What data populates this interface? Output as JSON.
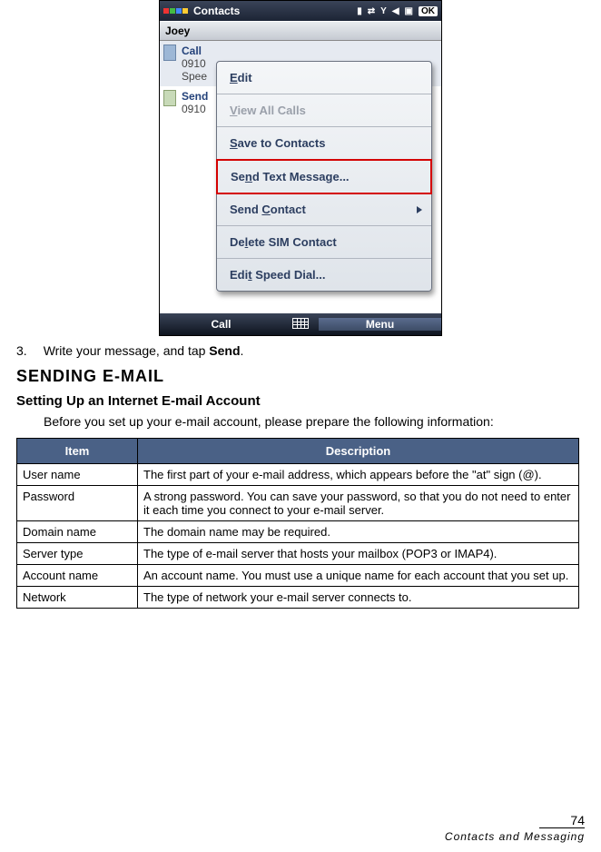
{
  "screenshot": {
    "statusbar": {
      "title": "Contacts",
      "ok": "OK"
    },
    "subheader": "Joey",
    "entries": [
      {
        "line1": "Call",
        "line2a": "0910",
        "line2b": "Spee"
      },
      {
        "line1": "Send",
        "line2a": "0910"
      }
    ],
    "menu": {
      "edit": "Edit",
      "viewall": "View All Calls",
      "savecontacts": "Save to Contacts",
      "sendtext": "Send Text Message...",
      "sendcontact": "Send Contact",
      "deletesim": "Delete SIM Contact",
      "editspeed": "Edit Speed Dial..."
    },
    "softkeys": {
      "left": "Call",
      "right": "Menu"
    }
  },
  "step3": {
    "pre": "Write your message, and tap ",
    "bold": "Send",
    "post": "."
  },
  "heading": "Sending e-mail",
  "subheading": "Setting Up an Internet E-mail Account",
  "intro": "Before you set up your e-mail account, please prepare the following information:",
  "table": {
    "head": {
      "item": "Item",
      "desc": "Description"
    },
    "rows": [
      {
        "item": "User name",
        "desc": "The first part of your e-mail address, which appears before the \"at\" sign (@)."
      },
      {
        "item": "Password",
        "desc": "A strong password. You can save your password, so that you do not need to enter it each time you connect to your e-mail server."
      },
      {
        "item": "Domain name",
        "desc": "The domain name may be required."
      },
      {
        "item": "Server type",
        "desc": "The type of e-mail server that hosts your mailbox (POP3 or IMAP4)."
      },
      {
        "item": "Account name",
        "desc": "An account name. You must use a unique name for each account that you set up."
      },
      {
        "item": "Network",
        "desc": "The type of network your e-mail server connects to."
      }
    ]
  },
  "footer": {
    "page": "74",
    "category": "Contacts and Messaging"
  }
}
